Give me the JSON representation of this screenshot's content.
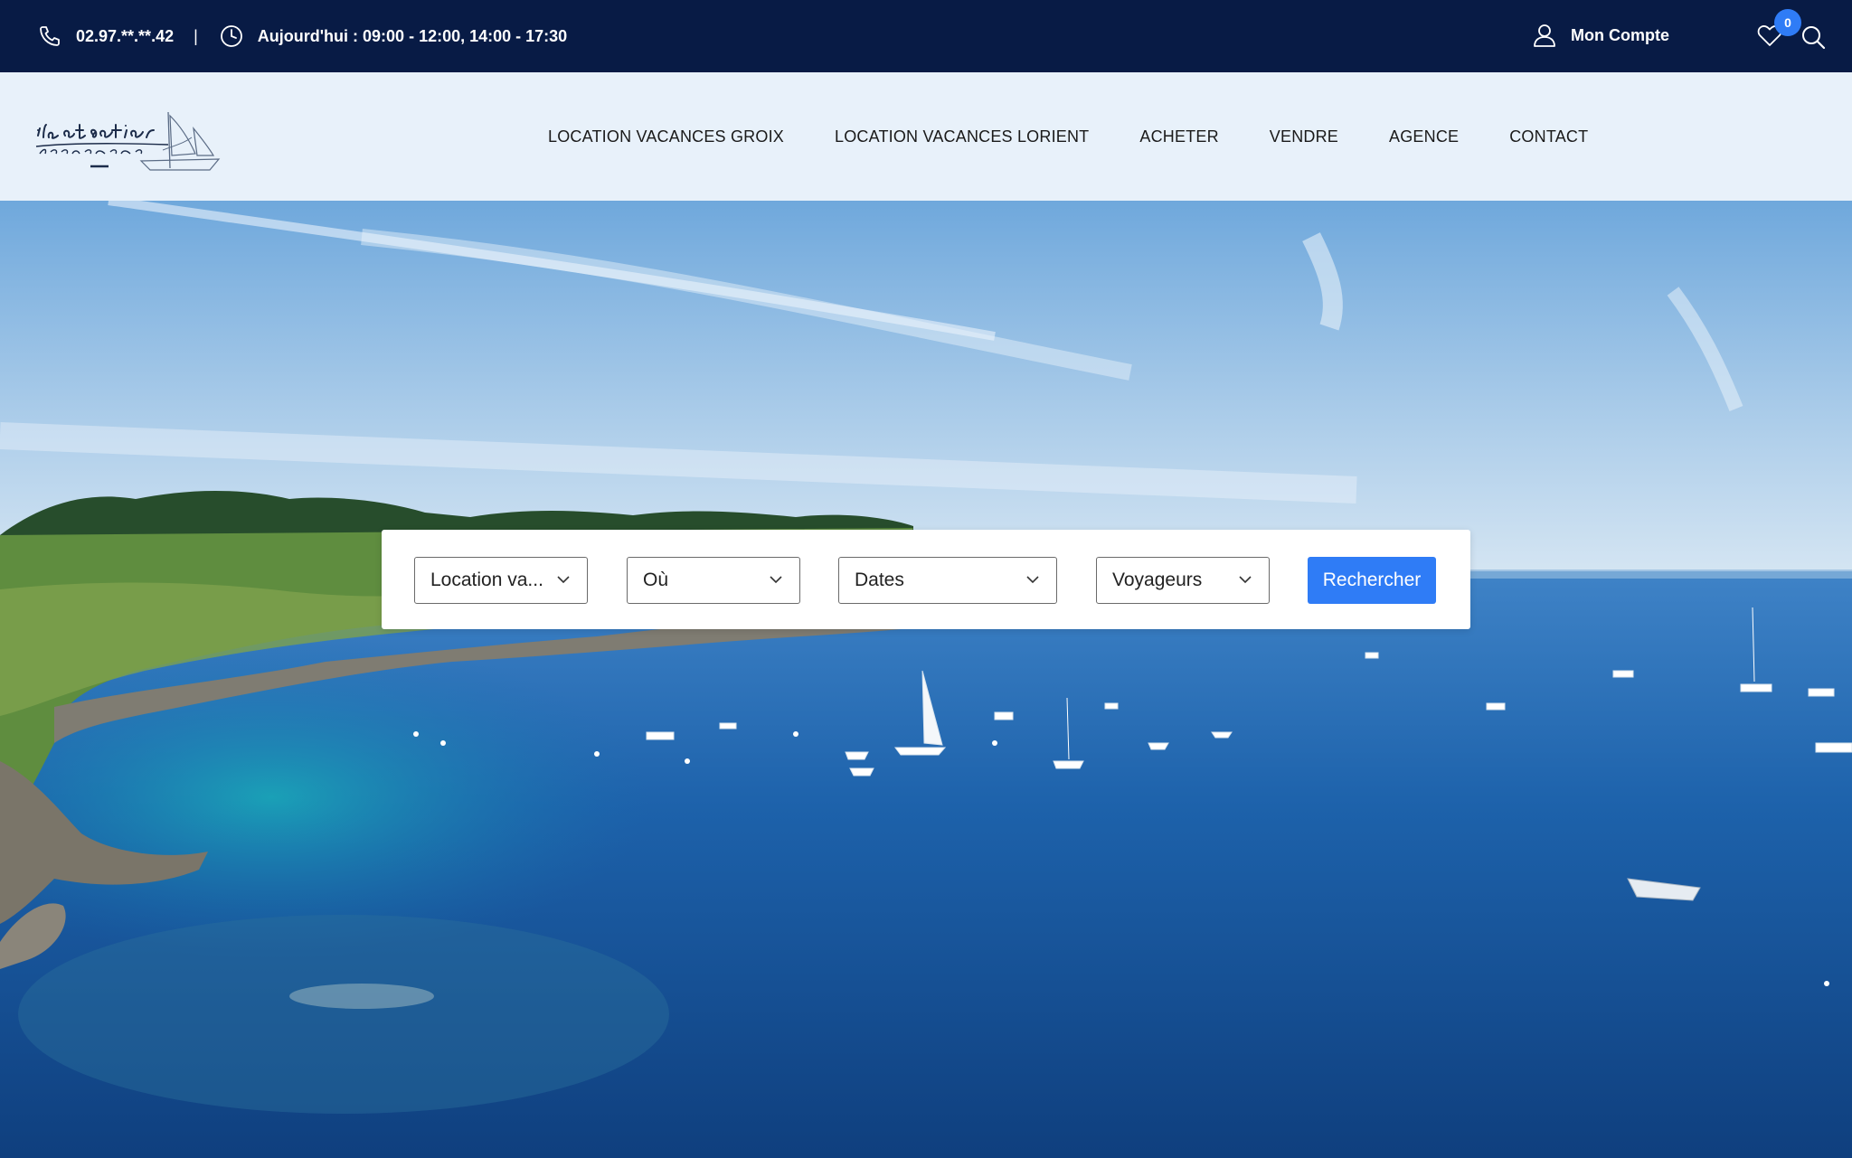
{
  "topbar": {
    "phone": "02.97.**.**.42",
    "separator": "|",
    "hours": "Aujourd'hui : 09:00 - 12:00, 14:00 - 17:30",
    "account_label": "Mon Compte",
    "wishlist_count": "0"
  },
  "nav": {
    "items": [
      "LOCATION VACANCES GROIX",
      "LOCATION VACANCES LORIENT",
      "ACHETER",
      "VENDRE",
      "AGENCE",
      "CONTACT"
    ]
  },
  "search": {
    "type_value": "Location va...",
    "where_value": "Où",
    "dates_value": "Dates",
    "guests_value": "Voyageurs",
    "button_label": "Rechercher"
  },
  "colors": {
    "topbar_bg": "#081b45",
    "header_bg": "#e8f1fa",
    "accent": "#2f7cf6"
  },
  "icons": [
    "phone-icon",
    "clock-icon",
    "user-icon",
    "heart-icon",
    "search-icon",
    "chevron-down-icon"
  ]
}
